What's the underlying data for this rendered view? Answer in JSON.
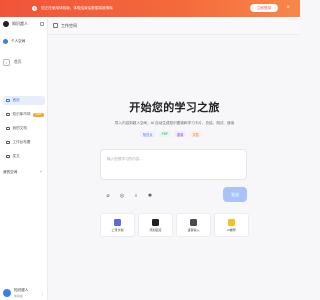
{
  "banner": {
    "text": "您正在使用体验版，体验结束后数据将被清除",
    "action_label": "立即登录",
    "close_glyph": "×",
    "warn_glyph": "!"
  },
  "sidebar": {
    "brand": "知识超人",
    "user": "个人空间",
    "back_label": "首页",
    "items": [
      {
        "label": "首页",
        "active": true
      },
      {
        "label": "知识库市场",
        "badge": "NEW"
      },
      {
        "label": "我的文档"
      },
      {
        "label": "工作台布置"
      },
      {
        "label": "发文"
      }
    ],
    "section_title": "我的空间",
    "section_add": "+"
  },
  "footer_user": {
    "name": "知识超人",
    "subtitle": "体验版"
  },
  "topbar": {
    "title": "工作空间"
  },
  "hero": {
    "title": "开始您的学习之旅",
    "subtitle": "导入内容到超人空间，AI 自动生成知识图谱和学习卡片，总结、测试、速读",
    "chips": [
      "知识点",
      "PDF",
      "图谱",
      "文档"
    ]
  },
  "input": {
    "placeholder": "输入您想学习的内容..."
  },
  "tools": [
    "⌀",
    "◎",
    "⌕",
    "✱"
  ],
  "send_label": "发送",
  "cards": [
    {
      "label": "上传文档",
      "color": "#5b6bdc"
    },
    {
      "label": "添加链接",
      "color": "#222222"
    },
    {
      "label": "语音输入",
      "color": "#4a4a4a"
    },
    {
      "label": "AI推荐",
      "color": "#f5c028"
    }
  ],
  "colors": {
    "banner": "#f1543a",
    "accent": "#3f6fd8",
    "send_button": "#a9c3f6"
  }
}
